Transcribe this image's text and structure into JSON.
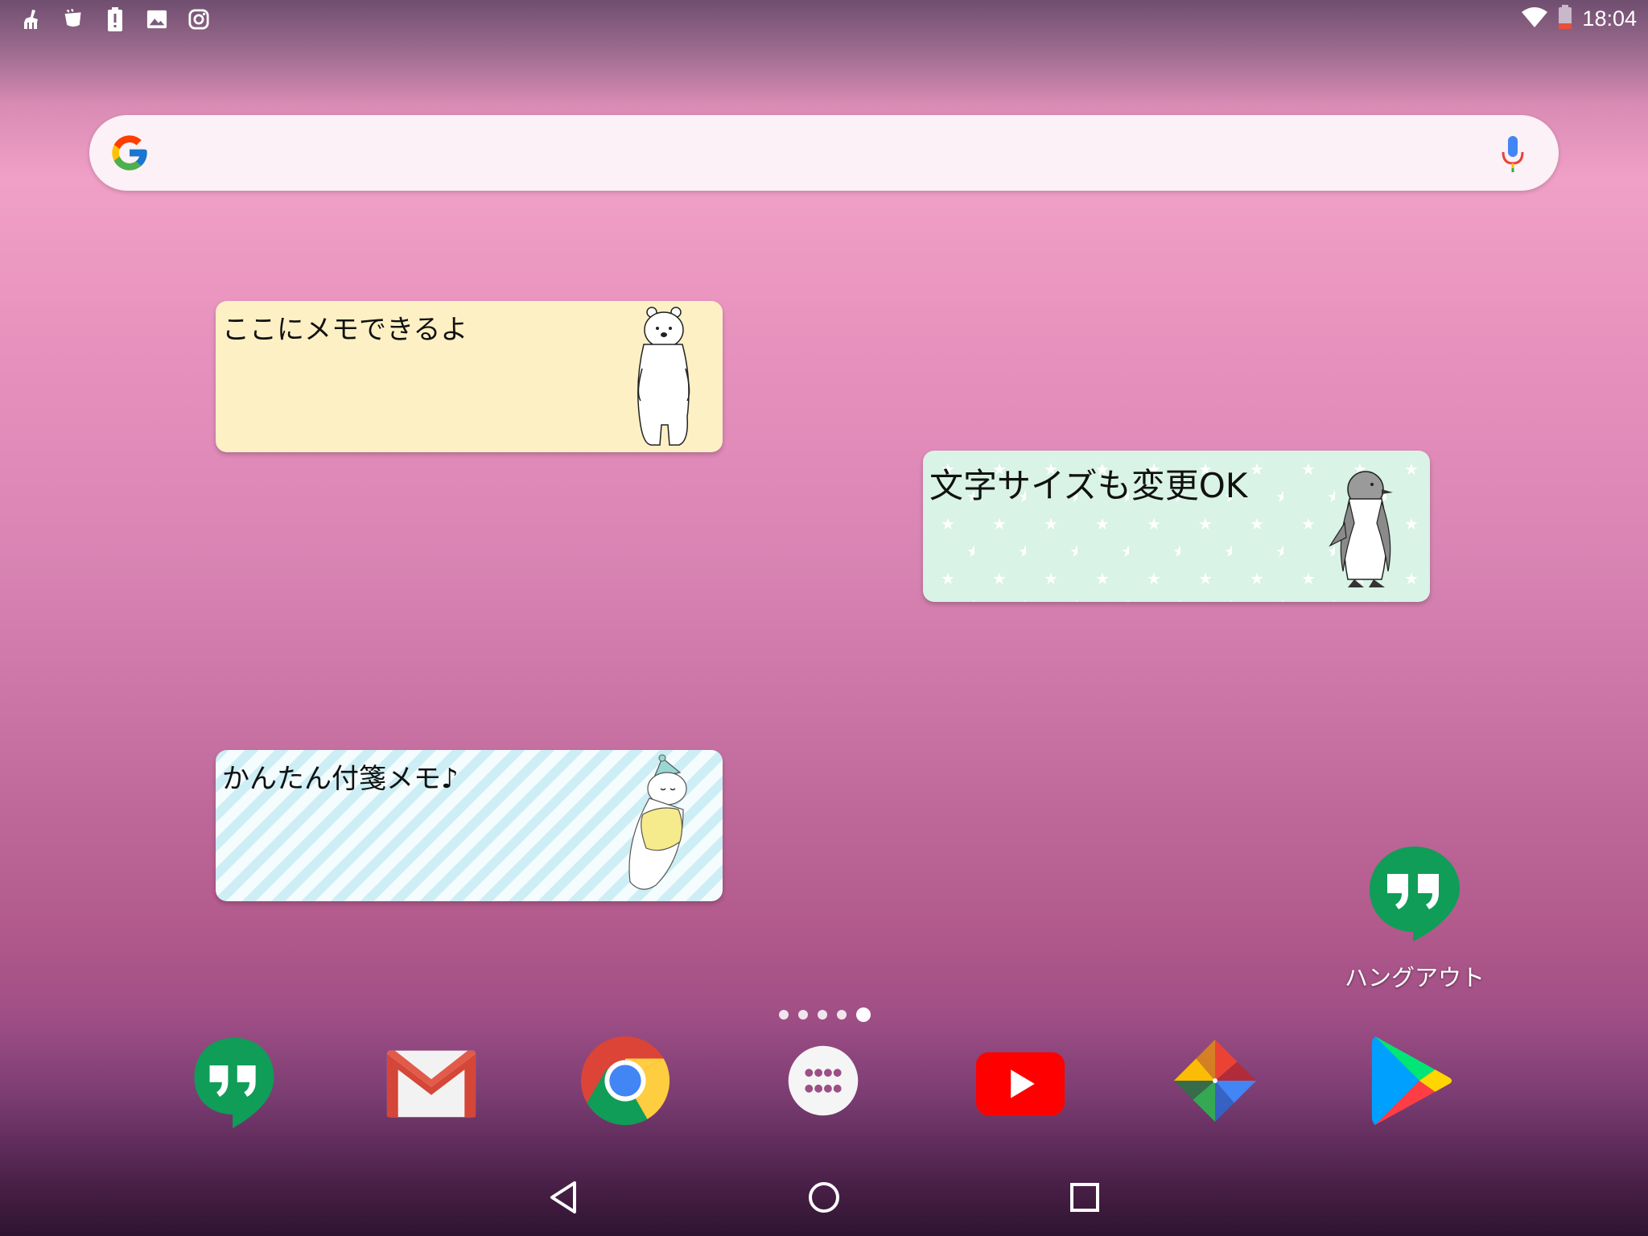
{
  "status_bar": {
    "left_icons": [
      "broom-icon",
      "cup-icon",
      "battery-alert-icon",
      "image-icon",
      "instagram-icon"
    ],
    "right_icons": [
      "wifi-icon",
      "battery-icon"
    ],
    "time": "18:04"
  },
  "search": {
    "logo": "google-g-icon",
    "placeholder": "",
    "mic": "mic-icon"
  },
  "memos": [
    {
      "text": "ここにメモできるよ",
      "background": "#fdf0c5",
      "illustration": "polar-bear-illustration"
    },
    {
      "text": "文字サイズも変更OK",
      "background": "#d9f3e6",
      "illustration": "penguin-illustration"
    },
    {
      "text": "かんたん付箋メモ♪",
      "background": "#cdeef5",
      "illustration": "sleeping-bear-illustration"
    }
  ],
  "shortcut": {
    "label": "ハングアウト",
    "icon": "hangouts-icon"
  },
  "pager": {
    "count": 5,
    "active": 4
  },
  "dock": [
    "hangouts-icon",
    "gmail-icon",
    "chrome-icon",
    "app-drawer-icon",
    "youtube-icon",
    "photos-icon",
    "play-store-icon"
  ],
  "nav": [
    "back-icon",
    "home-icon",
    "recents-icon"
  ],
  "colors": {
    "hangouts": "#0f9d58",
    "youtube": "#ff0000",
    "gmail_red": "#d44638"
  }
}
